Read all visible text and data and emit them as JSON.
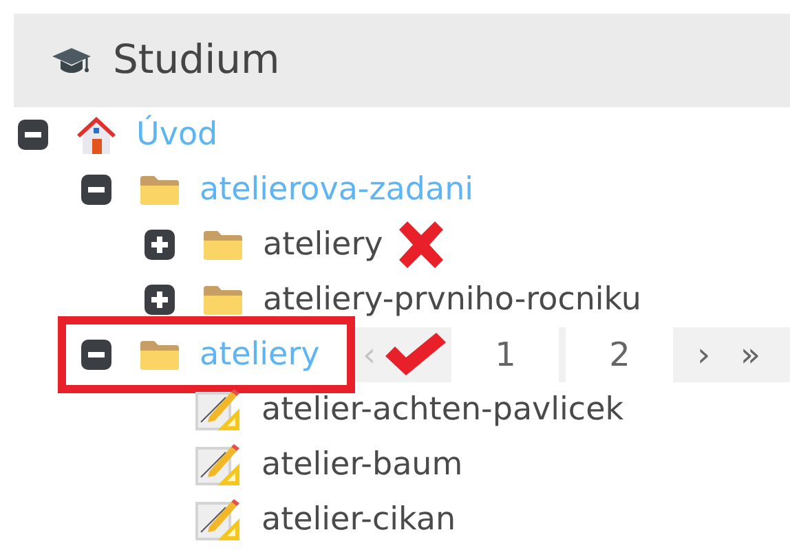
{
  "header": {
    "title": "Studium"
  },
  "tree": [
    {
      "label": "Úvod",
      "kind": "home",
      "expanded": true,
      "children": [
        {
          "label": "atelierova-zadani",
          "kind": "folder",
          "expanded": true,
          "children": [
            {
              "label": "ateliery",
              "kind": "folder",
              "expanded": false,
              "crossed": true
            },
            {
              "label": "ateliery-prvniho-rocniku",
              "kind": "folder",
              "expanded": false
            }
          ]
        },
        {
          "label": "ateliery",
          "kind": "folder",
          "expanded": true,
          "highlighted": true,
          "checked": true,
          "pager": [
            {
              "label": "‹",
              "disabled": true
            },
            {
              "label": "1",
              "disabled": false
            },
            {
              "label": "2",
              "disabled": false
            },
            {
              "label": "›",
              "disabled": false
            },
            {
              "label": "»",
              "disabled": false
            }
          ],
          "children": [
            {
              "label": "atelier-achten-pavlicek",
              "kind": "document"
            },
            {
              "label": "atelier-baum",
              "kind": "document"
            },
            {
              "label": "atelier-cikan",
              "kind": "document"
            }
          ]
        }
      ]
    }
  ]
}
